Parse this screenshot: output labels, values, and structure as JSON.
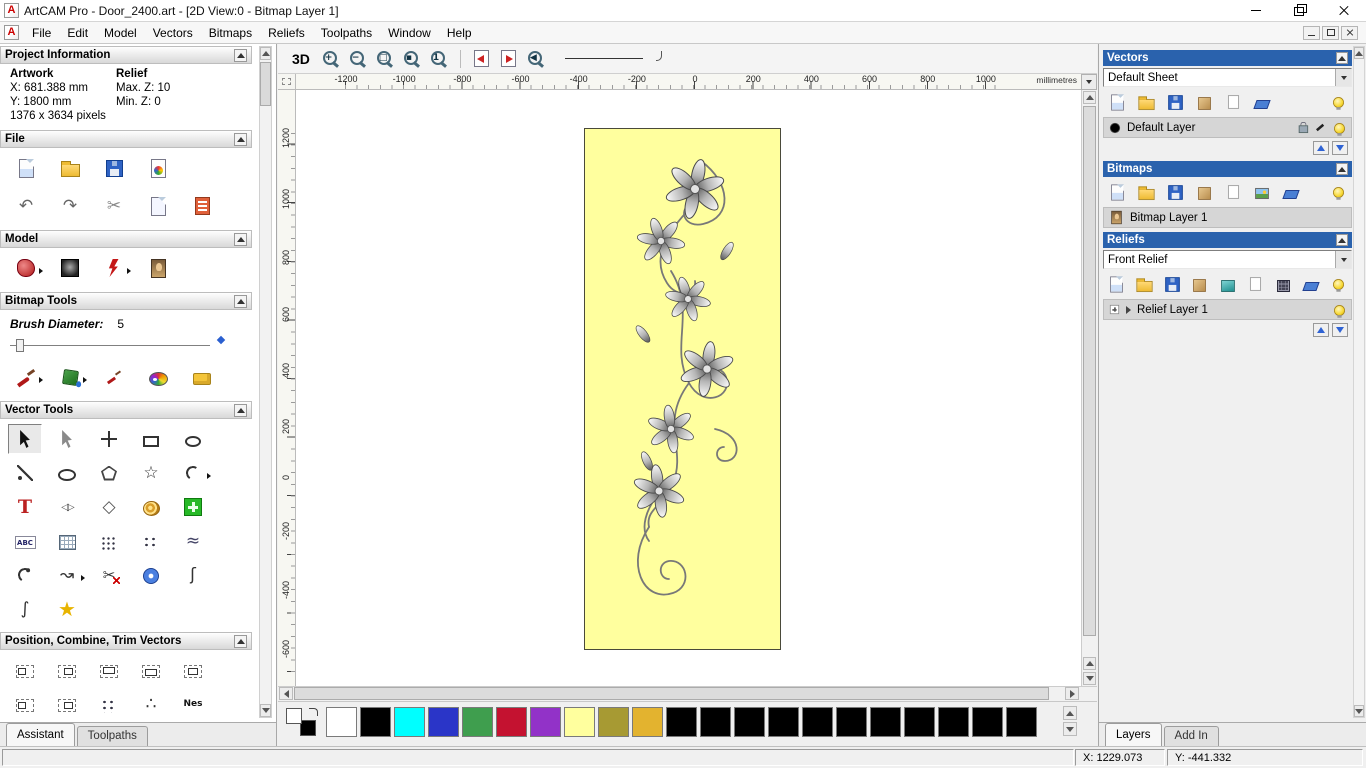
{
  "app": {
    "icon_letter": "A"
  },
  "window": {
    "title": "ArtCAM Pro - Door_2400.art - [2D View:0 - Bitmap Layer 1]"
  },
  "menu": {
    "items": [
      "File",
      "Edit",
      "Model",
      "Vectors",
      "Bitmaps",
      "Reliefs",
      "Toolpaths",
      "Window",
      "Help"
    ]
  },
  "assistant": {
    "sections": {
      "project_information": "Project Information",
      "file": "File",
      "model": "Model",
      "bitmap_tools": "Bitmap Tools",
      "vector_tools": "Vector Tools",
      "position": "Position, Combine, Trim Vectors"
    },
    "project": {
      "artwork_label": "Artwork",
      "relief_label": "Relief",
      "artwork_x": "X: 681.388 mm",
      "artwork_y": "Y: 1800 mm",
      "artwork_pixels": "1376 x 3634 pixels",
      "relief_max_z": "Max. Z: 10",
      "relief_min_z": "Min. Z: 0"
    },
    "file_icons_row1": [
      {
        "name": "new-model-icon",
        "shape": "page-blue"
      },
      {
        "name": "open-model-icon",
        "shape": "folder"
      },
      {
        "name": "save-model-icon",
        "shape": "floppy"
      },
      {
        "name": "import-model-icon",
        "shape": "import"
      }
    ],
    "file_icons_row2": [
      {
        "name": "undo-icon",
        "glyph": "↶",
        "color": "#666"
      },
      {
        "name": "redo-icon",
        "glyph": "↷",
        "color": "#666"
      },
      {
        "name": "cut-icon",
        "glyph": "✂",
        "color": "#888"
      },
      {
        "name": "paste-icon",
        "shape": "page-light"
      },
      {
        "name": "notes-icon",
        "shape": "notes"
      }
    ],
    "model_icons": [
      {
        "name": "relief-mask-icon",
        "shape": "mask",
        "dd": "1"
      },
      {
        "name": "greyscale-preview-icon",
        "shape": "preview"
      },
      {
        "name": "smooth-relief-icon",
        "shape": "bolt",
        "dd": "1"
      },
      {
        "name": "bitmap-portrait-icon",
        "shape": "portrait"
      }
    ],
    "brush": {
      "label": "Brush Diameter:",
      "value": "5"
    },
    "bitmap_tool_icons": [
      {
        "name": "paint-brush-icon",
        "shape": "brush",
        "dd": "1"
      },
      {
        "name": "flood-fill-icon",
        "shape": "fill",
        "dd": "1"
      },
      {
        "name": "paint-selective-icon",
        "shape": "brush2"
      },
      {
        "name": "colour-palette-icon",
        "shape": "palette"
      },
      {
        "name": "eraser-sponge-icon",
        "shape": "sponge"
      }
    ],
    "vector_tool_icons": [
      {
        "name": "select-vectors-icon",
        "shape": "cursor",
        "press": "1"
      },
      {
        "name": "node-editing-icon",
        "shape": "cursor2"
      },
      {
        "name": "transform-vectors-icon",
        "shape": "move"
      },
      {
        "name": "create-rectangle-icon",
        "shape": "rect"
      },
      {
        "name": "create-ellipse-icon",
        "shape": "ellipse"
      },
      {
        "name": "create-polyline-icon",
        "shape": "polyline"
      },
      {
        "name": "create-circle-icon",
        "shape": "oval"
      },
      {
        "name": "create-polygon-icon",
        "shape": "pentagon"
      },
      {
        "name": "create-star-icon",
        "glyph": "☆",
        "color": "#333"
      },
      {
        "name": "create-arc-icon",
        "shape": "arc",
        "dd": "1"
      },
      {
        "name": "create-text-icon",
        "glyph": "T",
        "shape": "textT"
      },
      {
        "name": "mirror-vectors-icon",
        "glyph": "◁▷",
        "shape": "small",
        "color": "#555"
      },
      {
        "name": "create-diamond-icon",
        "glyph": "◇",
        "color": "#555"
      },
      {
        "name": "spiral-shell-icon",
        "shape": "shell"
      },
      {
        "name": "block-copy-icon",
        "shape": "plusgreen"
      },
      {
        "name": "paragraph-text-icon",
        "glyph": "ABC",
        "shape": "abc"
      },
      {
        "name": "grid-tool-icon",
        "shape": "grid"
      },
      {
        "name": "paste-array-icon",
        "shape": "dots"
      },
      {
        "name": "point-cloud-icon",
        "shape": "scatter"
      },
      {
        "name": "wave-measure-icon",
        "glyph": "≈",
        "color": "#446"
      },
      {
        "name": "arc-fit-icon",
        "shape": "arc2"
      },
      {
        "name": "offset-vector-icon",
        "glyph": "↝",
        "color": "#333",
        "dd": "1"
      },
      {
        "name": "trim-vectors-icon",
        "glyph": "✂",
        "shape": "trimx",
        "color": "#333"
      },
      {
        "name": "create-torus-icon",
        "shape": "torus"
      },
      {
        "name": "fit-curve-icon",
        "glyph": "ʃ",
        "color": "#333"
      },
      {
        "name": "section-profile-icon",
        "glyph": "∫",
        "color": "#333"
      },
      {
        "name": "wrap-star-icon",
        "glyph": "★",
        "shape": "stargold",
        "color": "#e8b400"
      }
    ],
    "position_icons": [
      {
        "name": "align-left-icon",
        "shape": "al1"
      },
      {
        "name": "align-center-icon",
        "shape": "al2"
      },
      {
        "name": "align-top-icon",
        "shape": "al3"
      },
      {
        "name": "align-bottom-icon",
        "shape": "al4"
      },
      {
        "name": "align-inside-icon",
        "shape": "al5"
      },
      {
        "name": "combine-vectors-icon",
        "shape": "al1"
      },
      {
        "name": "subtract-vectors-icon",
        "shape": "al2"
      },
      {
        "name": "scatter-copies-icon",
        "shape": "scatter"
      },
      {
        "name": "paste-along-curve-icon",
        "glyph": "∴",
        "color": "#333"
      },
      {
        "name": "nesting-icon",
        "glyph": "Nes",
        "shape": "nes"
      }
    ],
    "tabs": [
      {
        "label": "Assistant",
        "active": "1"
      },
      {
        "label": "Toolpaths"
      }
    ]
  },
  "toolbar2d": {
    "view_3d_label": "3D",
    "zoom_icons": [
      {
        "name": "zoom-in-icon",
        "shape": "mag",
        "glyph": "+"
      },
      {
        "name": "zoom-out-icon",
        "shape": "mag",
        "glyph": "−"
      },
      {
        "name": "zoom-window-icon",
        "shape": "mag",
        "glyph": "□"
      },
      {
        "name": "zoom-objects-icon",
        "shape": "mag",
        "glyph": "▪"
      },
      {
        "name": "zoom-scale-icon",
        "shape": "mag",
        "glyph": "1"
      }
    ],
    "view_icons": [
      {
        "name": "snap-grid-page-icon",
        "shape": "pan-l"
      },
      {
        "name": "snap-guides-page-icon",
        "shape": "pan-r"
      },
      {
        "name": "previous-view-icon",
        "shape": "mag",
        "glyph": "◀"
      }
    ]
  },
  "ruler": {
    "h_ticks": [
      "-1200",
      "-1000",
      "-800",
      "-600",
      "-400",
      "-200",
      "0",
      "200",
      "400",
      "600",
      "800",
      "1000"
    ],
    "v_ticks": [
      "1200",
      "1000",
      "800",
      "600",
      "400",
      "200",
      "0",
      "-200",
      "-400",
      "-600"
    ],
    "units": "millimetres"
  },
  "palette": {
    "swatches": [
      "#ffffff",
      "#000000",
      "#00ffff",
      "#2a35c8",
      "#3f9e4e",
      "#c41230",
      "#9232c8",
      "#ffff9e",
      "#a79a33",
      "#e3b32f",
      "#000000",
      "#000000",
      "#000000",
      "#000000",
      "#000000",
      "#000000",
      "#000000",
      "#000000",
      "#000000",
      "#000000",
      "#000000"
    ]
  },
  "layers_panel": {
    "vectors": {
      "title": "Vectors",
      "sheet": "Default Sheet",
      "icons": [
        {
          "name": "new-vector-layer-icon",
          "shape": "page-blue"
        },
        {
          "name": "open-vector-layer-icon",
          "shape": "folder"
        },
        {
          "name": "save-vector-layer-icon",
          "shape": "floppy"
        },
        {
          "name": "merge-vector-layers-icon",
          "shape": "tan"
        },
        {
          "name": "copy-vector-layer-icon",
          "shape": "blank"
        },
        {
          "name": "delete-vector-layer-icon",
          "shape": "eraser"
        },
        {
          "name": "toggle-vectors-visibility-icon",
          "shape": "bulb"
        }
      ],
      "layer": {
        "label": "Default Layer"
      }
    },
    "bitmaps": {
      "title": "Bitmaps",
      "icons": [
        {
          "name": "new-bitmap-layer-icon",
          "shape": "page-blue"
        },
        {
          "name": "open-bitmap-layer-icon",
          "shape": "folder"
        },
        {
          "name": "save-bitmap-layer-icon",
          "shape": "floppy"
        },
        {
          "name": "merge-bitmap-layers-icon",
          "shape": "tan"
        },
        {
          "name": "copy-bitmap-layer-icon",
          "shape": "blank"
        },
        {
          "name": "bitmap-colours-icon",
          "shape": "image"
        },
        {
          "name": "delete-bitmap-layer-icon",
          "shape": "eraser"
        },
        {
          "name": "toggle-bitmaps-visibility-icon",
          "shape": "bulb"
        }
      ],
      "layer": {
        "label": "Bitmap Layer 1"
      }
    },
    "reliefs": {
      "title": "Reliefs",
      "relief": "Front Relief",
      "icons": [
        {
          "name": "new-relief-layer-icon",
          "shape": "page-blue"
        },
        {
          "name": "open-relief-layer-icon",
          "shape": "folder"
        },
        {
          "name": "save-relief-layer-icon",
          "shape": "floppy"
        },
        {
          "name": "merge-relief-layers-icon",
          "shape": "tan"
        },
        {
          "name": "relief-surface-icon",
          "shape": "teal"
        },
        {
          "name": "copy-relief-layer-icon",
          "shape": "blank"
        },
        {
          "name": "relief-grid-icon",
          "shape": "gridd"
        },
        {
          "name": "delete-relief-layer-icon",
          "shape": "eraser"
        },
        {
          "name": "toggle-reliefs-visibility-icon",
          "shape": "bulb"
        }
      ],
      "layer": {
        "label": "Relief Layer 1"
      }
    },
    "tabs": [
      {
        "label": "Layers",
        "active": "1"
      },
      {
        "label": "Add In"
      }
    ]
  },
  "status": {
    "x": "X: 1229.073",
    "y": "Y: -441.332"
  }
}
